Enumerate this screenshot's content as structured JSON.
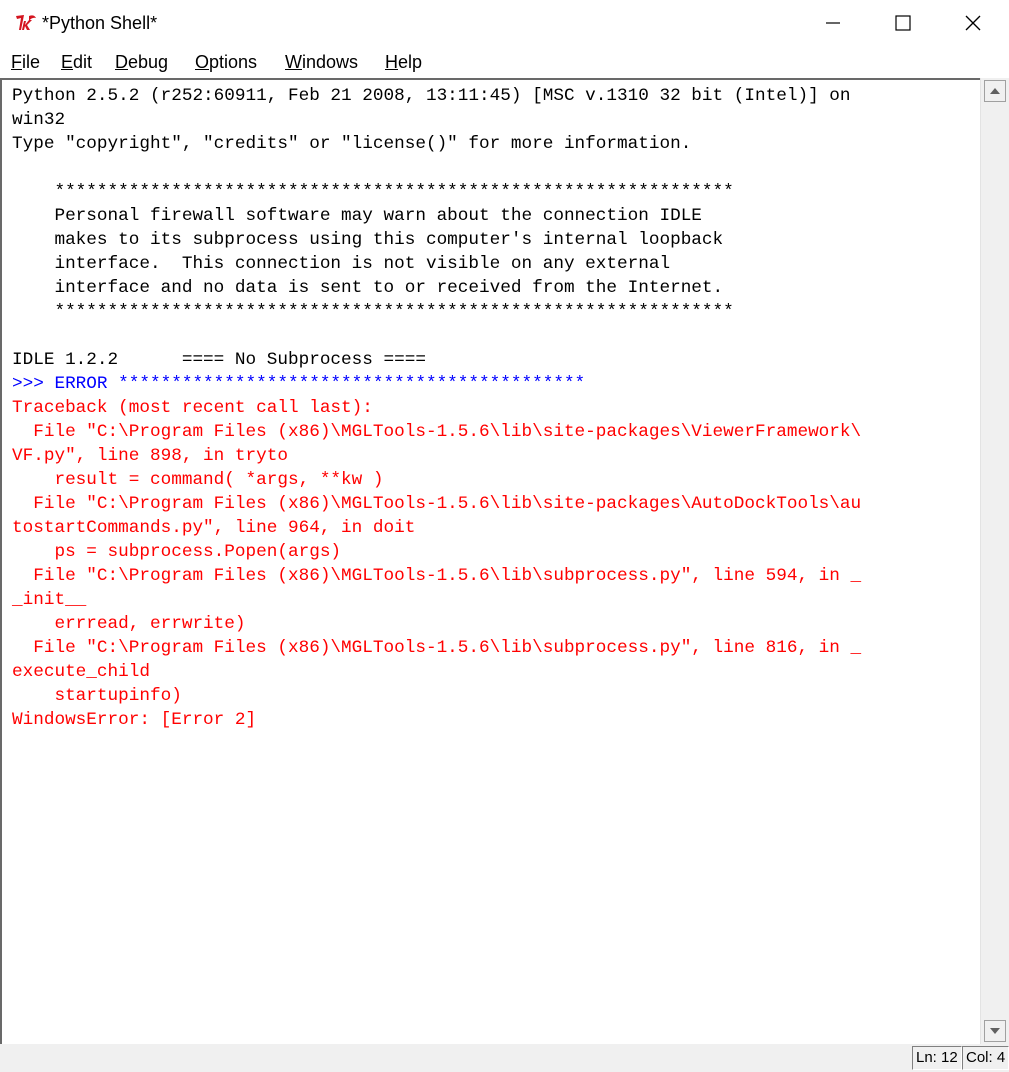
{
  "window": {
    "title": "*Python Shell*",
    "app_icon": "tk-feather-icon",
    "controls": [
      "minimize-icon",
      "maximize-icon",
      "close-icon"
    ]
  },
  "menubar": {
    "items": [
      {
        "label": "File",
        "mnemonic": "F",
        "rest": "ile"
      },
      {
        "label": "Edit",
        "mnemonic": "E",
        "rest": "dit"
      },
      {
        "label": "Debug",
        "mnemonic": "D",
        "rest": "ebug"
      },
      {
        "label": "Options",
        "mnemonic": "O",
        "rest": "ptions"
      },
      {
        "label": "Windows",
        "mnemonic": "W",
        "rest": "indows"
      },
      {
        "label": "Help",
        "mnemonic": "H",
        "rest": "elp"
      }
    ]
  },
  "shell": {
    "lines": [
      {
        "text": "Python 2.5.2 (r252:60911, Feb 21 2008, 13:11:45) [MSC v.1310 32 bit (Intel)] on",
        "color": "black"
      },
      {
        "text": "win32",
        "color": "black"
      },
      {
        "text": "Type \"copyright\", \"credits\" or \"license()\" for more information.",
        "color": "black"
      },
      {
        "text": "",
        "color": "black"
      },
      {
        "text": "    ****************************************************************",
        "color": "black"
      },
      {
        "text": "    Personal firewall software may warn about the connection IDLE",
        "color": "black"
      },
      {
        "text": "    makes to its subprocess using this computer's internal loopback",
        "color": "black"
      },
      {
        "text": "    interface.  This connection is not visible on any external",
        "color": "black"
      },
      {
        "text": "    interface and no data is sent to or received from the Internet.",
        "color": "black"
      },
      {
        "text": "    ****************************************************************",
        "color": "black"
      },
      {
        "text": "",
        "color": "black"
      },
      {
        "text": "IDLE 1.2.2      ==== No Subprocess ====",
        "color": "black"
      },
      {
        "text": ">>> ERROR ********************************************",
        "color": "blue"
      },
      {
        "text": "Traceback (most recent call last):",
        "color": "red"
      },
      {
        "text": "  File \"C:\\Program Files (x86)\\MGLTools-1.5.6\\lib\\site-packages\\ViewerFramework\\",
        "color": "red"
      },
      {
        "text": "VF.py\", line 898, in tryto",
        "color": "red"
      },
      {
        "text": "    result = command( *args, **kw )",
        "color": "red"
      },
      {
        "text": "  File \"C:\\Program Files (x86)\\MGLTools-1.5.6\\lib\\site-packages\\AutoDockTools\\au",
        "color": "red"
      },
      {
        "text": "tostartCommands.py\", line 964, in doit",
        "color": "red"
      },
      {
        "text": "    ps = subprocess.Popen(args)",
        "color": "red"
      },
      {
        "text": "  File \"C:\\Program Files (x86)\\MGLTools-1.5.6\\lib\\subprocess.py\", line 594, in _",
        "color": "red"
      },
      {
        "text": "_init__",
        "color": "red"
      },
      {
        "text": "    errread, errwrite)",
        "color": "red"
      },
      {
        "text": "  File \"C:\\Program Files (x86)\\MGLTools-1.5.6\\lib\\subprocess.py\", line 816, in _",
        "color": "red"
      },
      {
        "text": "execute_child",
        "color": "red"
      },
      {
        "text": "    startupinfo)",
        "color": "red"
      },
      {
        "text": "WindowsError: [Error 2]",
        "color": "red"
      }
    ],
    "colors": {
      "black": "#000000",
      "red": "#ff0000",
      "blue": "#0000ff",
      "prompt": "#a020f0"
    }
  },
  "scrollbar": {
    "up_icon": "scroll-up-arrow-icon",
    "down_icon": "scroll-down-arrow-icon"
  },
  "statusbar": {
    "line": "Ln: 12",
    "col": "Col: 4"
  }
}
